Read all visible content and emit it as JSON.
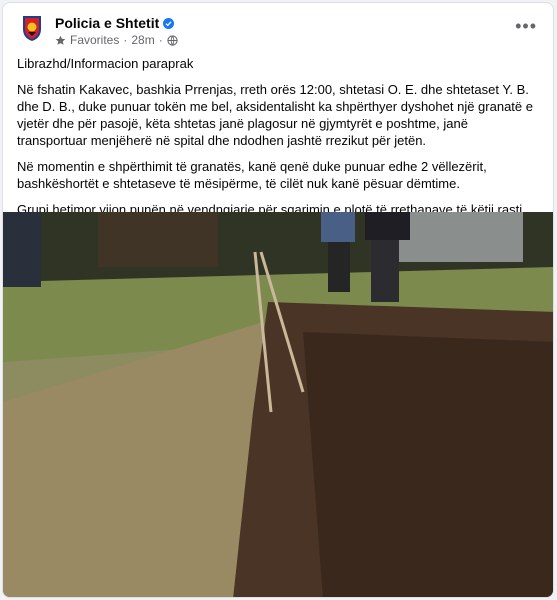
{
  "header": {
    "page_name": "Policia e Shtetit",
    "audience": "Favorites",
    "time": "28m",
    "separator": "·",
    "more_label": "•••"
  },
  "post": {
    "paragraphs": [
      "Librazhd/Informacion paraprak",
      "Në fshatin Kakavec, bashkia Prrenjas, rreth orës 12:00, shtetasi O. E. dhe shtetaset Y. B. dhe D. B., duke punuar tokën me bel, aksidentalisht ka shpërthyer dyshohet një granatë e vjetër dhe për pasojë, këta shtetas janë plagosur në gjymtyrët e poshtme, janë transportuar menjëherë në spital dhe ndodhen jashtë rrezikut për jetën.",
      "Në momentin e shpërthimit të granatës, kanë qenë duke punuar edhe 2 vëllezërit, bashkëshortët e shtetaseve të mësipërme, të cilët nuk kanë pësuar dëmtime.",
      "Grupi hetimor vijon punën në vendngjarje për sqarimin e plotë të rrethanave të këtij rasti."
    ]
  },
  "icons": {
    "avatar": "police-badge-logo",
    "verified": "verified-badge-icon",
    "favorites": "star-icon",
    "privacy": "globe-icon",
    "more": "more-options-icon"
  },
  "colors": {
    "verified_blue": "#1877f2",
    "secondary_text": "#65676b",
    "primary_text": "#050505"
  }
}
